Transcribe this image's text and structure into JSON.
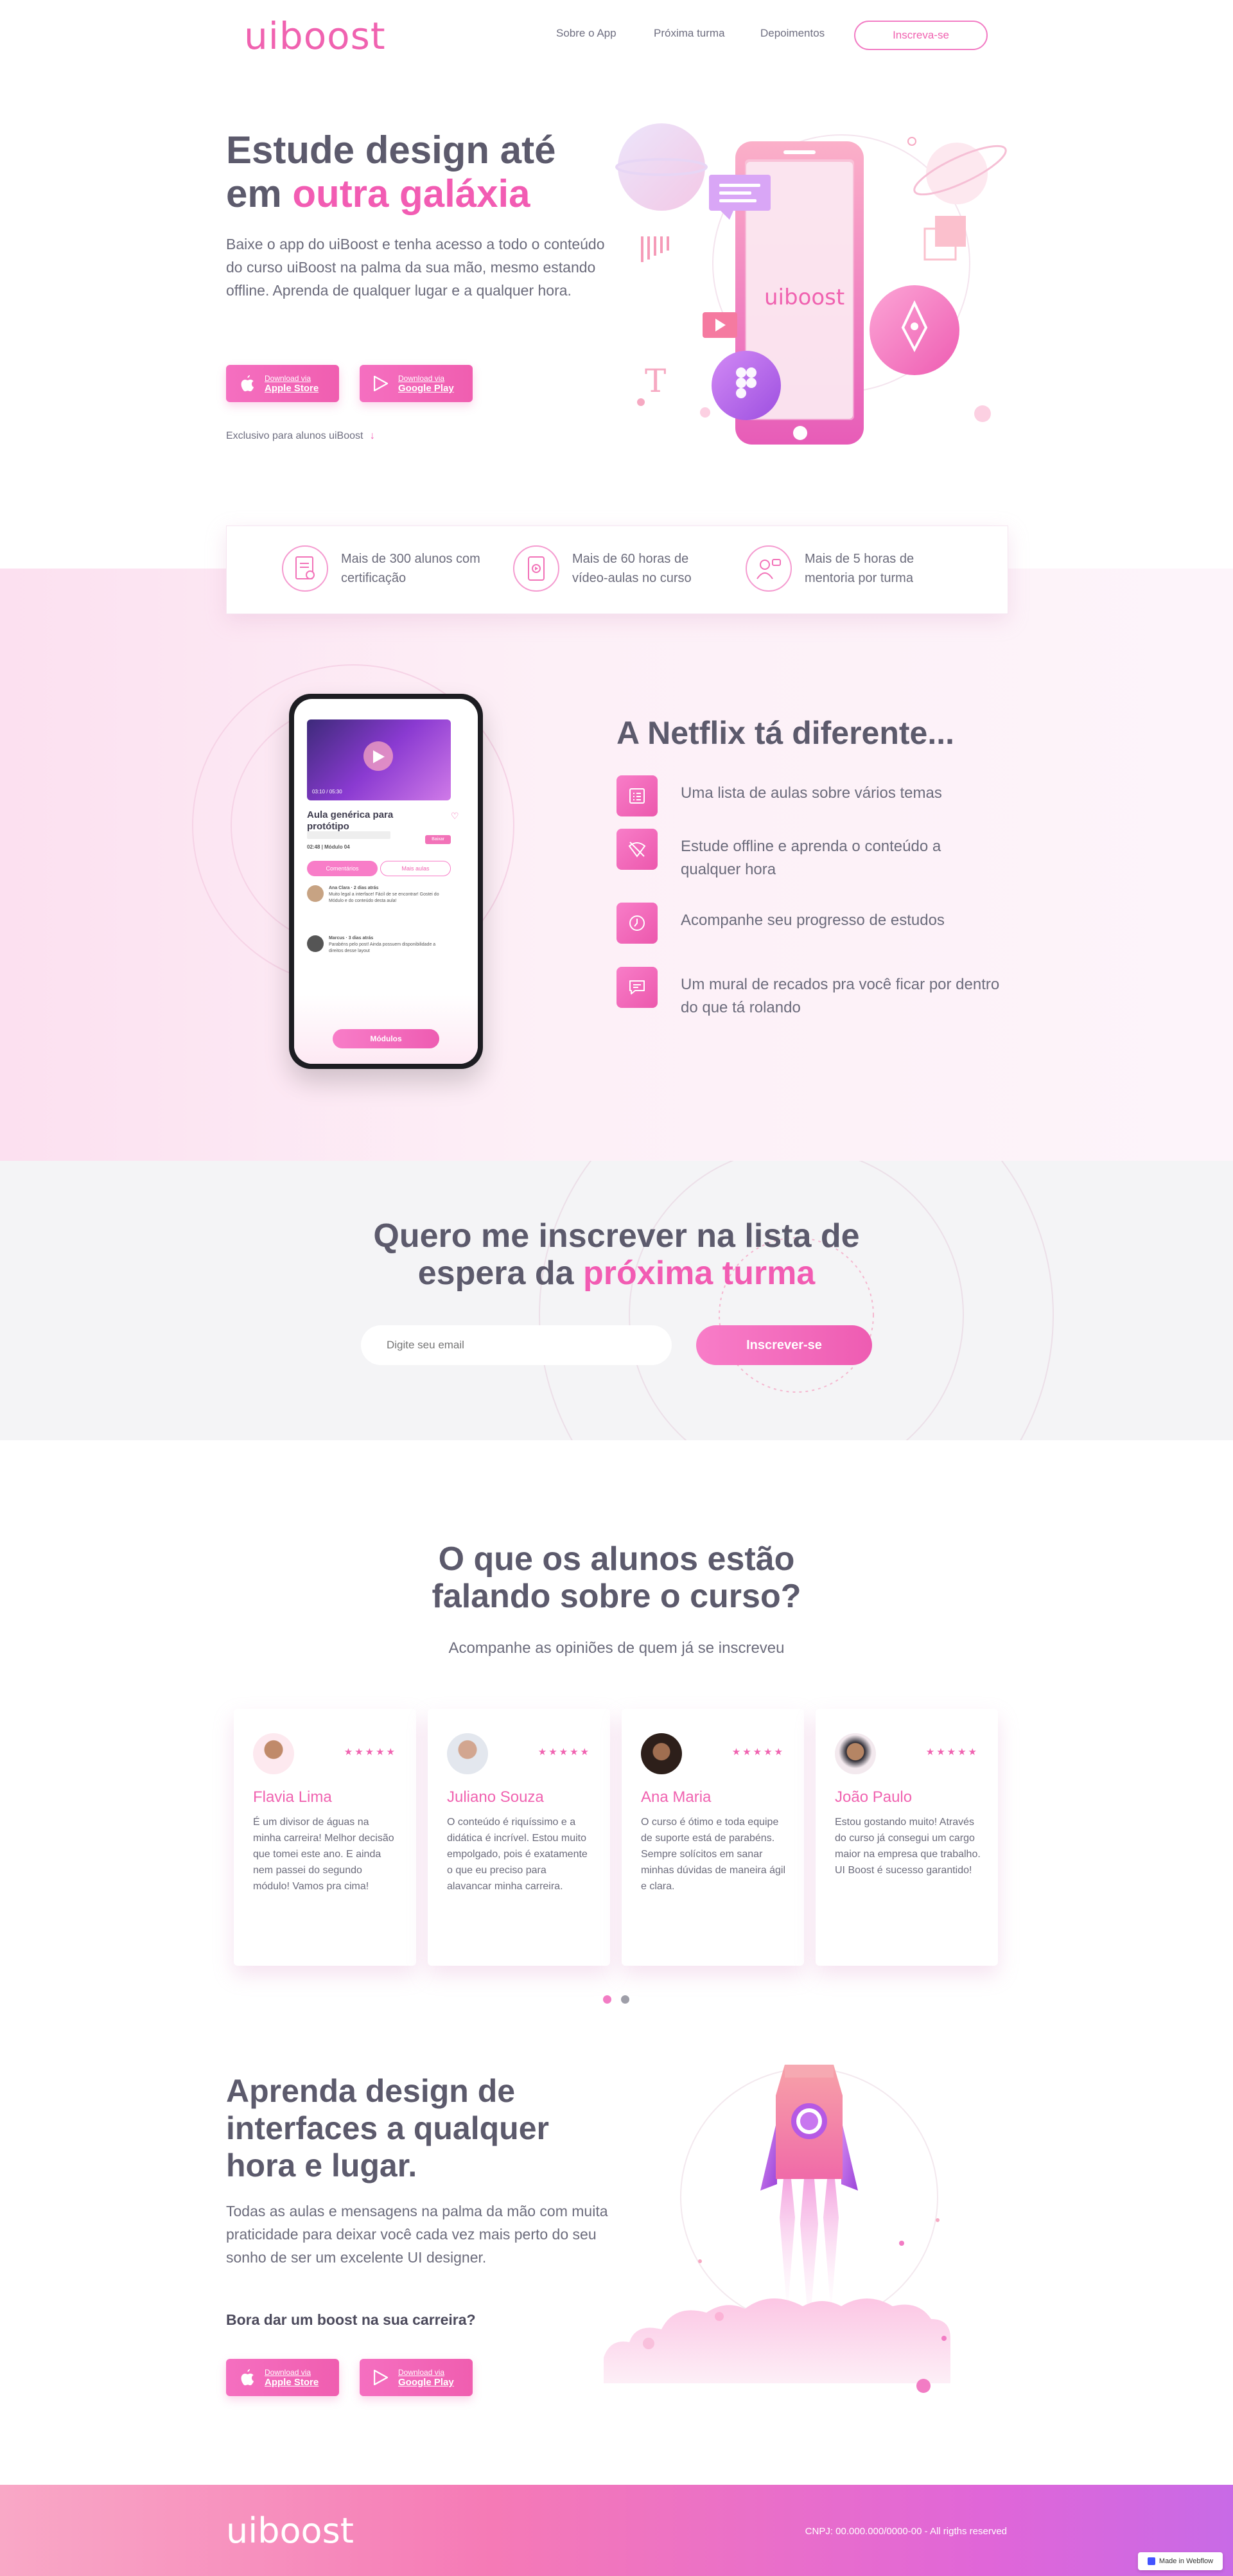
{
  "header": {
    "logo": "uiboost",
    "nav": [
      "Sobre o App",
      "Próxima turma",
      "Depoimentos"
    ],
    "cta": "Inscreva-se"
  },
  "hero": {
    "title_1": "Estude design até",
    "title_2a": "em ",
    "title_2b": "outra galáxia",
    "description": "Baixe o app do uiBoost e tenha acesso a todo o conteúdo do curso uiBoost na palma da sua mão, mesmo estando offline. Aprenda de qualquer lugar e a qualquer hora.",
    "apple": {
      "small": "Download via",
      "big": "Apple Store"
    },
    "google": {
      "small": "Download via",
      "big": "Google Play"
    },
    "note": "Exclusivo para alunos uiBoost",
    "phone_logo": "uiboost"
  },
  "stats": [
    {
      "text": "Mais de 300 alunos com certificação",
      "icon": "certificate-icon"
    },
    {
      "text": "Mais de 60 horas de vídeo-aulas no curso",
      "icon": "phone-video-icon"
    },
    {
      "text": "Mais de 5 horas de mentoria por turma",
      "icon": "mentor-icon"
    }
  ],
  "netflix": {
    "title": "A Netflix tá diferente...",
    "features": [
      {
        "text": "Uma lista de aulas sobre vários temas",
        "icon": "list-icon"
      },
      {
        "text": "Estude offline e aprenda o conteúdo a qualquer hora",
        "icon": "offline-icon"
      },
      {
        "text": "Acompanhe seu progresso de estudos",
        "icon": "progress-icon"
      },
      {
        "text": "Um mural de recados pra você ficar por dentro do que tá rolando",
        "icon": "message-icon"
      }
    ],
    "phone": {
      "lesson_title": "Aula genérica para protótipo",
      "lesson_meta": "02:48 | Módulo 04",
      "tab_1": "Comentários",
      "tab_2": "Mais aulas",
      "tag": "Baixar",
      "modules_button": "Módulos",
      "time": "03:10 / 05:30",
      "comment_1_author": "Ana Clara · 2 dias atrás",
      "comment_1_text": "Muito legal a interface! Fácil de se encontrar! Gostei do Módulo e do conteúdo desta aula!",
      "comment_2_author": "Marcus · 3 dias atrás",
      "comment_2_text": "Parabéns pelo post! Ainda possuem disponibilidade a direitos desse layout"
    }
  },
  "waitlist": {
    "title_1": "Quero me inscrever na lista de",
    "title_2a": "espera da ",
    "title_2b": "próxima turma",
    "placeholder": "Digite seu email",
    "button": "Inscrever-se"
  },
  "testimonials": {
    "title_1": "O que os alunos estão",
    "title_2": "falando sobre o curso?",
    "subtitle": "Acompanhe as opiniões de quem já se inscreveu",
    "cards": [
      {
        "name": "Flavia Lima",
        "stars": "★★★★★",
        "quote": "É um divisor de águas na minha carreira! Melhor decisão que tomei este ano. E ainda nem passei do segundo módulo! Vamos pra cima!"
      },
      {
        "name": "Juliano Souza",
        "stars": "★★★★★",
        "quote": "O conteúdo é riquíssimo e a didática é incrível. Estou muito empolgado, pois é exatamente o que eu preciso para alavancar minha carreira."
      },
      {
        "name": "Ana Maria",
        "stars": "★★★★★",
        "quote": "O curso é ótimo e toda equipe de suporte está de parabéns. Sempre solícitos em sanar minhas dúvidas de maneira ágil e clara."
      },
      {
        "name": "João Paulo",
        "stars": "★★★★★",
        "quote": "Estou gostando muito! Através do curso já consegui um cargo maior na empresa que trabalho. UI Boost é sucesso garantido!"
      }
    ]
  },
  "final": {
    "title": "Aprenda design de interfaces a qualquer hora e lugar.",
    "description": "Todas as aulas e mensagens na palma da mão com muita praticidade para deixar você cada vez mais perto do seu sonho de ser um excelente UI designer.",
    "bold": "Bora dar um boost na sua carreira?",
    "apple": {
      "small": "Download via",
      "big": "Apple Store"
    },
    "google": {
      "small": "Download via",
      "big": "Google Play"
    }
  },
  "footer": {
    "logo": "uiboost",
    "cnpj": "CNPJ: 00.000.000/0000-00 - All rigths reserved",
    "webflow": "Made in Webflow"
  },
  "colors": {
    "accent": "#f062b0",
    "text": "#5c5a6c"
  }
}
